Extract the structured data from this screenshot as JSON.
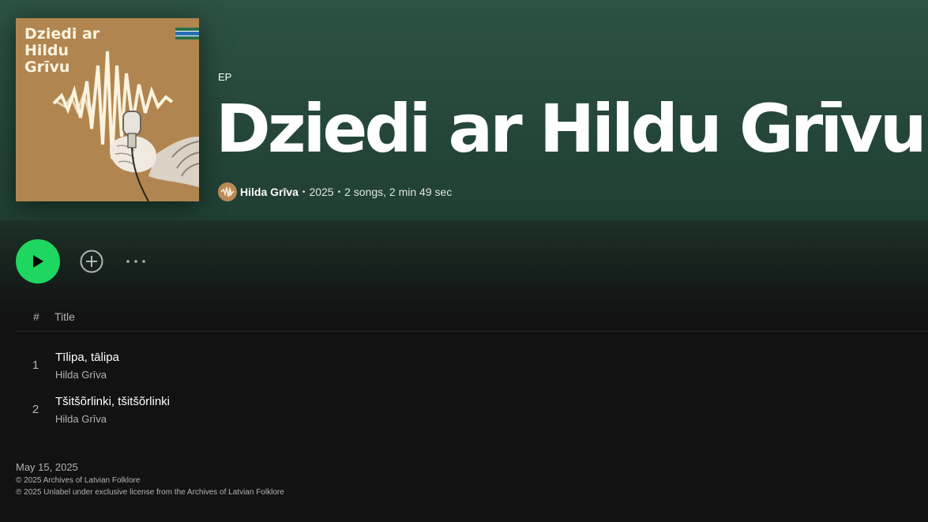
{
  "album": {
    "cover_text": "Dziedi ar Hildu Grīvu",
    "type": "EP",
    "title": "Dziedi ar Hildu Grīvu",
    "artist": "Hilda Grīva",
    "year": "2025",
    "summary": "2 songs, 2 min 49 sec",
    "separator": "•"
  },
  "table": {
    "num_header": "#",
    "title_header": "Title"
  },
  "tracks": [
    {
      "number": "1",
      "title": "Tīlipa, tālipa",
      "artist": "Hilda Grīva"
    },
    {
      "number": "2",
      "title": "Tšitšõrlinki, tšitšõrlinki",
      "artist": "Hilda Grīva"
    }
  ],
  "footer": {
    "release_date": "May 15, 2025",
    "copyright": "© 2025 Archives of Latvian Folklore",
    "phonogram": "℗ 2025 Unlabel under exclusive license from the Archives of Latvian Folklore"
  },
  "colors": {
    "accent": "#1ed760",
    "hero_bg": "#2c5242",
    "page_bg": "#121212",
    "cover_bg": "#b1854f"
  },
  "icons": {
    "play": "play-icon",
    "add": "add-circle-icon",
    "more": "more-dots-icon",
    "flag": "flag-icon"
  }
}
